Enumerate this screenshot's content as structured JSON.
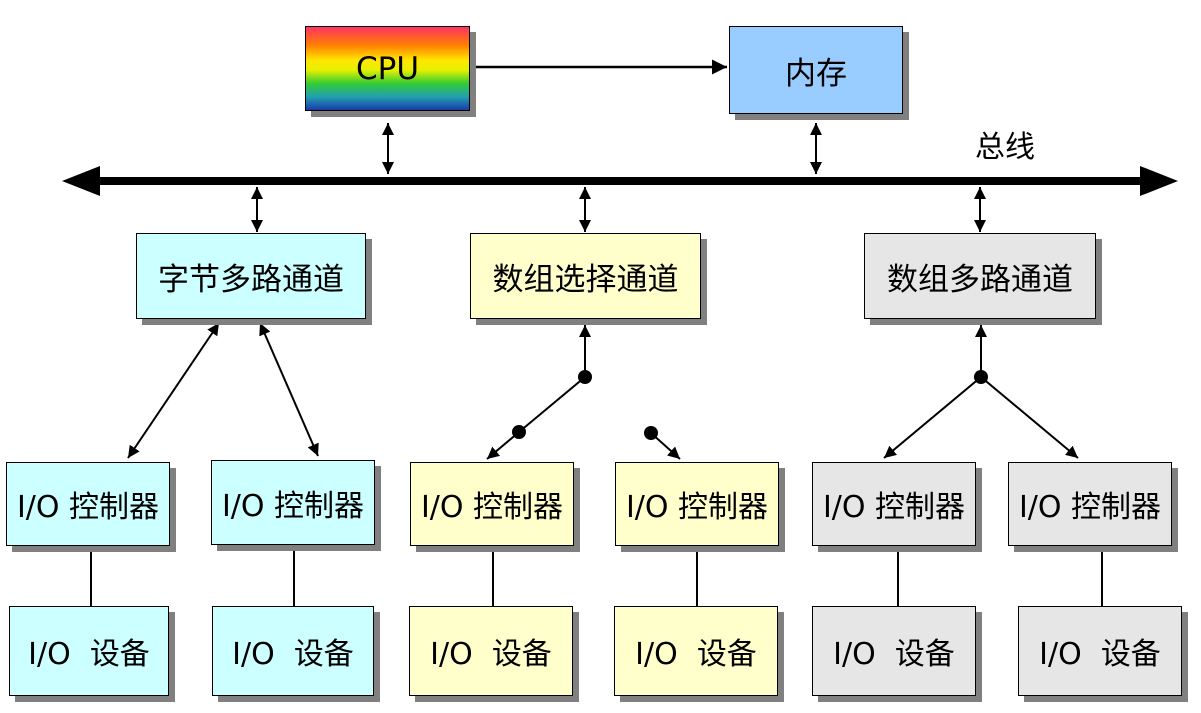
{
  "cpu": {
    "label": "CPU"
  },
  "memory": {
    "label": "内存"
  },
  "bus": {
    "label": "总线"
  },
  "channels": [
    {
      "label": "字节多路通道",
      "color": "#ccffff"
    },
    {
      "label": "数组选择通道",
      "color": "#ffffcc"
    },
    {
      "label": "数组多路通道",
      "color": "#e6e6e6"
    }
  ],
  "controllers": [
    {
      "label": "I/O 控制器"
    },
    {
      "label": "I/O 控制器"
    },
    {
      "label": "I/O 控制器"
    },
    {
      "label": "I/O 控制器"
    },
    {
      "label": "I/O 控制器"
    },
    {
      "label": "I/O 控制器"
    }
  ],
  "devices": [
    {
      "label": "I/O  设备"
    },
    {
      "label": "I/O  设备"
    },
    {
      "label": "I/O  设备"
    },
    {
      "label": "I/O  设备"
    },
    {
      "label": "I/O  设备"
    },
    {
      "label": "I/O  设备"
    }
  ]
}
